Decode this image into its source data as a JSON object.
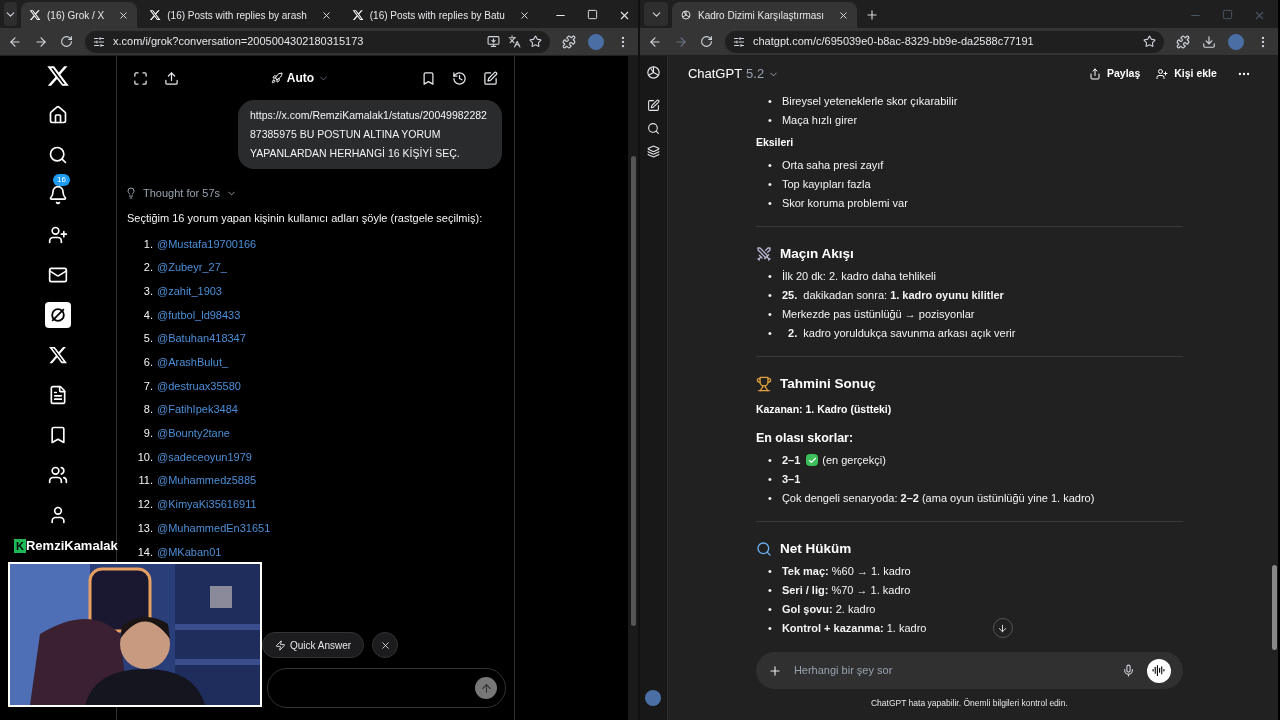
{
  "left_browser": {
    "tabs": [
      {
        "title": "(16) Grok / X",
        "selected": true
      },
      {
        "title": "(16) Posts with replies by arash",
        "selected": false
      },
      {
        "title": "(16) Posts with replies by Batu",
        "selected": false
      }
    ],
    "address": "x.com/i/grok?conversation=2005004302180315173"
  },
  "x_sidebar": {
    "items": [
      {
        "kind": "home",
        "selected": false
      },
      {
        "kind": "search",
        "selected": false
      },
      {
        "kind": "bell",
        "selected": false,
        "badge": "16"
      },
      {
        "kind": "follow",
        "selected": false
      },
      {
        "kind": "mail",
        "selected": false
      },
      {
        "kind": "grok",
        "selected": true
      },
      {
        "kind": "x",
        "selected": false
      },
      {
        "kind": "list",
        "selected": false
      },
      {
        "kind": "bookmark",
        "selected": false
      },
      {
        "kind": "people",
        "selected": false
      },
      {
        "kind": "profile",
        "selected": false
      }
    ]
  },
  "grok": {
    "mode": "Auto",
    "user_message": "https://x.com/RemziKamalak1/status/2004998228287385975 BU POSTUN ALTINA YORUM YAPANLARDAN HERHANGİ 16 KİŞİYİ SEÇ.",
    "thought": "Thought for 57s",
    "intro": "Seçtiğim 16 yorum yapan kişinin kullanıcı adları şöyle (rastgele seçilmiş):",
    "list": [
      {
        "number": "1.",
        "handle": "@Mustafa19700166"
      },
      {
        "number": "2.",
        "handle": "@Zubeyr_27_"
      },
      {
        "number": "3.",
        "handle": "@zahit_1903"
      },
      {
        "number": "4.",
        "handle": "@futbol_ld98433"
      },
      {
        "number": "5.",
        "handle": "@Batuhan418347"
      },
      {
        "number": "6.",
        "handle": "@ArashBulut_"
      },
      {
        "number": "7.",
        "handle": "@destruax35580"
      },
      {
        "number": "8.",
        "handle": "@FatihIpek3484"
      },
      {
        "number": "9.",
        "handle": "@Bounty2tane"
      },
      {
        "number": "10.",
        "handle": "@sadeceoyun1979"
      },
      {
        "number": "11.",
        "handle": "@Muhammedz5885"
      },
      {
        "number": "12.",
        "handle": "@KimyaKi35616911"
      },
      {
        "number": "13.",
        "handle": "@MuhammedEn31651"
      },
      {
        "number": "14.",
        "handle": "@MKaban01"
      }
    ],
    "quick_answer": "Quick Answer"
  },
  "overlay": {
    "logo": "K",
    "name": "RemziKamalak"
  },
  "right_browser": {
    "tabs": [
      {
        "title": "Kadro Dizimi Karşılaştırması",
        "selected": true
      }
    ],
    "address": "chatgpt.com/c/695039e0-b8ac-8329-bb9e-da2588c77191"
  },
  "chatgpt": {
    "model": "ChatGPT",
    "version": "5.2",
    "share": "Paylaş",
    "add_person": "Kişi ekle",
    "blocks": [
      {
        "kind": "bullets",
        "marker": "•",
        "items": [
          {
            "text": "Bireysel yeteneklerle skor çıkarabilir"
          },
          {
            "text": "Maça hızlı girer"
          }
        ]
      },
      {
        "kind": "label",
        "text": "Eksileri"
      },
      {
        "kind": "bullets",
        "marker": "•",
        "items": [
          {
            "text": "Orta saha presi zayıf"
          },
          {
            "text": "Top kayıpları fazla"
          },
          {
            "text": "Skor koruma problemi var"
          }
        ]
      },
      {
        "kind": "rule"
      },
      {
        "kind": "heading",
        "text": "Maçın Akışı"
      },
      {
        "kind": "bullets",
        "marker": "•",
        "items": [
          {
            "text": "İlk 20 dk: 2. kadro daha tehlikeli"
          },
          {
            "text": "**25.**  dakikadan sonra: **1. kadro oyunu kilitler**"
          },
          {
            "text": "Merkezde pas üstünlüğü → pozisyonlar"
          },
          {
            "text": "  **2.**  kadro yoruldukça savunma arkası açık verir"
          }
        ]
      },
      {
        "kind": "rule"
      },
      {
        "kind": "heading",
        "text": "Tahmini Sonuç"
      },
      {
        "kind": "label",
        "text": "Kazanan: 1. Kadro (üstteki)"
      },
      {
        "kind": "subheading",
        "text": "En olası skorlar:"
      },
      {
        "kind": "bullets",
        "marker": "•",
        "items": [
          {
            "text": "**2–1**",
            "check": true,
            "rest": "(en gerçekçi)"
          },
          {
            "text": "**3–1**"
          },
          {
            "text": "Çok dengeli senaryoda: **2–2** (ama oyun üstünlüğü yine 1. kadro)"
          }
        ]
      },
      {
        "kind": "rule"
      },
      {
        "kind": "heading",
        "text": "Net Hüküm"
      },
      {
        "kind": "bullets",
        "marker": "•",
        "items": [
          {
            "text": "**Tek maç:** %60 → 1. kadro"
          },
          {
            "text": "**Seri / lig:** %70 → 1. kadro"
          },
          {
            "text": "**Gol şovu:** 2. kadro"
          },
          {
            "text": "**Kontrol + kazanma:** 1. kadro"
          }
        ]
      }
    ],
    "composer_placeholder": "Herhangi bir şey sor",
    "disclaimer": "ChatGPT hata yapabilir. Önemli bilgileri kontrol edin."
  }
}
